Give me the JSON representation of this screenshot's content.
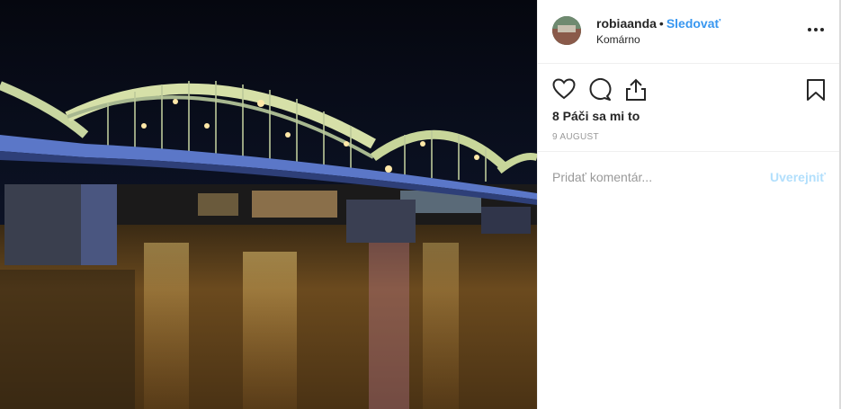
{
  "post": {
    "username": "robiaanda",
    "separator": "•",
    "follow_label": "Sledovať",
    "location": "Komárno",
    "likes_text": "8 Páči sa mi to",
    "date": "9 AUGUST"
  },
  "comment": {
    "placeholder": "Pridať komentár...",
    "post_label": "Uverejniť"
  },
  "icons": {
    "like": "heart-icon",
    "comment": "comment-icon",
    "share": "share-icon",
    "save": "bookmark-icon",
    "more": "more-options-icon"
  },
  "colors": {
    "link": "#3897f0",
    "post_disabled": "#b2dffc",
    "text": "#262626",
    "muted": "#999999"
  }
}
